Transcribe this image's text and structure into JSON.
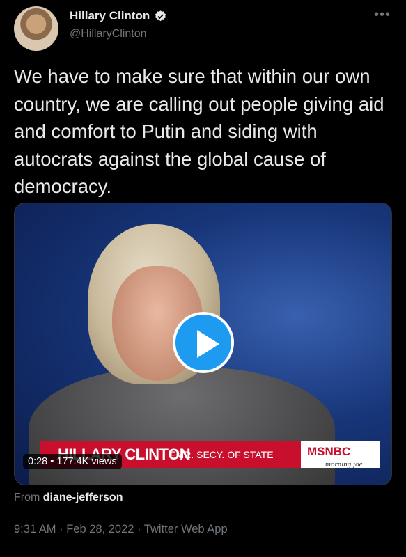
{
  "author": {
    "name": "Hillary Clinton",
    "handle": "@HillaryClinton",
    "verified_icon": "verified-badge-icon"
  },
  "more_icon": "more-options-icon",
  "tweet": {
    "text": "We have to make sure that within our own country, we are calling out people giving aid and comfort to Putin and siding with autocrats against the global cause of democracy."
  },
  "video": {
    "lower_third_name": "HILLARY CLINTON",
    "lower_third_title": "FMR. SECY. OF STATE",
    "network": "MSNBC",
    "show": "morning joe",
    "counter": "0:28 • 177.4K views",
    "play_icon": "play-icon"
  },
  "source": {
    "prefix": "From",
    "name": "diane-jefferson"
  },
  "meta": "9:31 AM · Feb 28, 2022 · Twitter Web App",
  "colors": {
    "accent": "#1d9bf0",
    "background": "#000000",
    "muted": "#71767b"
  }
}
